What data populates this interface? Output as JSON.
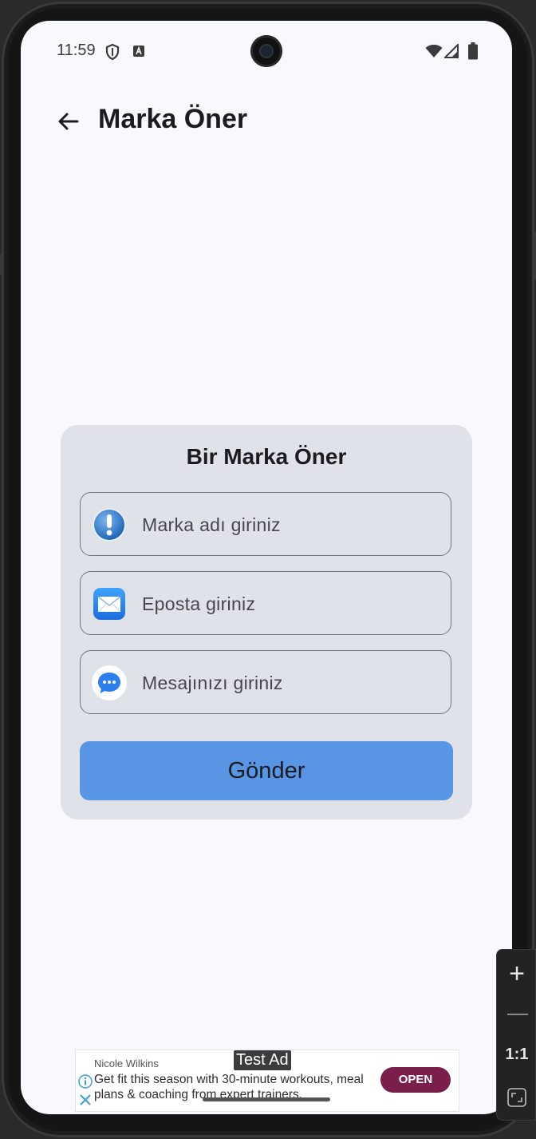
{
  "status_bar": {
    "time": "11:59"
  },
  "app_bar": {
    "title": "Marka Öner"
  },
  "form": {
    "title": "Bir Marka Öner",
    "fields": [
      {
        "placeholder": "Marka adı giriniz",
        "icon": "info-icon"
      },
      {
        "placeholder": "Eposta giriniz",
        "icon": "mail-icon"
      },
      {
        "placeholder": "Mesajınızı giriniz",
        "icon": "chat-bubble-icon"
      }
    ],
    "submit_label": "Gönder"
  },
  "ad": {
    "badge": "Test Ad",
    "advertiser": "Nicole Wilkins",
    "text": "Get fit this season with 30-minute workouts, meal plans & coaching from expert trainers.",
    "cta": "OPEN"
  },
  "zoom_controls": {
    "plus": "+",
    "reset": "1:1"
  },
  "colors": {
    "background": "#f8f9fe",
    "card": "#dfe2e8",
    "button": "#5995e5",
    "ad_cta": "#7a1e4c"
  }
}
